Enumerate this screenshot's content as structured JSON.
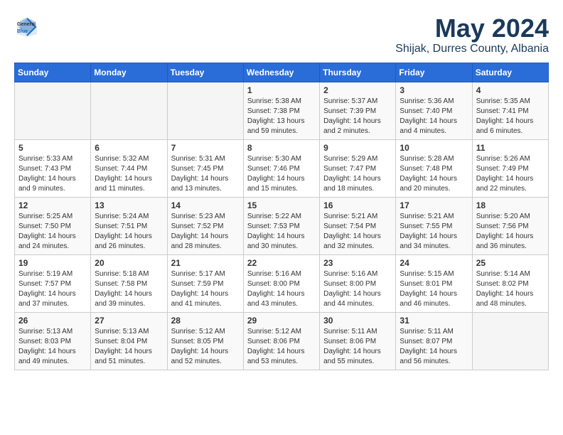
{
  "header": {
    "logo": {
      "general": "General",
      "blue": "Blue"
    },
    "month": "May 2024",
    "location": "Shijak, Durres County, Albania"
  },
  "days_of_week": [
    "Sunday",
    "Monday",
    "Tuesday",
    "Wednesday",
    "Thursday",
    "Friday",
    "Saturday"
  ],
  "weeks": [
    [
      {
        "day": "",
        "info": ""
      },
      {
        "day": "",
        "info": ""
      },
      {
        "day": "",
        "info": ""
      },
      {
        "day": "1",
        "sunrise": "Sunrise: 5:38 AM",
        "sunset": "Sunset: 7:38 PM",
        "daylight": "Daylight: 13 hours and 59 minutes."
      },
      {
        "day": "2",
        "sunrise": "Sunrise: 5:37 AM",
        "sunset": "Sunset: 7:39 PM",
        "daylight": "Daylight: 14 hours and 2 minutes."
      },
      {
        "day": "3",
        "sunrise": "Sunrise: 5:36 AM",
        "sunset": "Sunset: 7:40 PM",
        "daylight": "Daylight: 14 hours and 4 minutes."
      },
      {
        "day": "4",
        "sunrise": "Sunrise: 5:35 AM",
        "sunset": "Sunset: 7:41 PM",
        "daylight": "Daylight: 14 hours and 6 minutes."
      }
    ],
    [
      {
        "day": "5",
        "sunrise": "Sunrise: 5:33 AM",
        "sunset": "Sunset: 7:43 PM",
        "daylight": "Daylight: 14 hours and 9 minutes."
      },
      {
        "day": "6",
        "sunrise": "Sunrise: 5:32 AM",
        "sunset": "Sunset: 7:44 PM",
        "daylight": "Daylight: 14 hours and 11 minutes."
      },
      {
        "day": "7",
        "sunrise": "Sunrise: 5:31 AM",
        "sunset": "Sunset: 7:45 PM",
        "daylight": "Daylight: 14 hours and 13 minutes."
      },
      {
        "day": "8",
        "sunrise": "Sunrise: 5:30 AM",
        "sunset": "Sunset: 7:46 PM",
        "daylight": "Daylight: 14 hours and 15 minutes."
      },
      {
        "day": "9",
        "sunrise": "Sunrise: 5:29 AM",
        "sunset": "Sunset: 7:47 PM",
        "daylight": "Daylight: 14 hours and 18 minutes."
      },
      {
        "day": "10",
        "sunrise": "Sunrise: 5:28 AM",
        "sunset": "Sunset: 7:48 PM",
        "daylight": "Daylight: 14 hours and 20 minutes."
      },
      {
        "day": "11",
        "sunrise": "Sunrise: 5:26 AM",
        "sunset": "Sunset: 7:49 PM",
        "daylight": "Daylight: 14 hours and 22 minutes."
      }
    ],
    [
      {
        "day": "12",
        "sunrise": "Sunrise: 5:25 AM",
        "sunset": "Sunset: 7:50 PM",
        "daylight": "Daylight: 14 hours and 24 minutes."
      },
      {
        "day": "13",
        "sunrise": "Sunrise: 5:24 AM",
        "sunset": "Sunset: 7:51 PM",
        "daylight": "Daylight: 14 hours and 26 minutes."
      },
      {
        "day": "14",
        "sunrise": "Sunrise: 5:23 AM",
        "sunset": "Sunset: 7:52 PM",
        "daylight": "Daylight: 14 hours and 28 minutes."
      },
      {
        "day": "15",
        "sunrise": "Sunrise: 5:22 AM",
        "sunset": "Sunset: 7:53 PM",
        "daylight": "Daylight: 14 hours and 30 minutes."
      },
      {
        "day": "16",
        "sunrise": "Sunrise: 5:21 AM",
        "sunset": "Sunset: 7:54 PM",
        "daylight": "Daylight: 14 hours and 32 minutes."
      },
      {
        "day": "17",
        "sunrise": "Sunrise: 5:21 AM",
        "sunset": "Sunset: 7:55 PM",
        "daylight": "Daylight: 14 hours and 34 minutes."
      },
      {
        "day": "18",
        "sunrise": "Sunrise: 5:20 AM",
        "sunset": "Sunset: 7:56 PM",
        "daylight": "Daylight: 14 hours and 36 minutes."
      }
    ],
    [
      {
        "day": "19",
        "sunrise": "Sunrise: 5:19 AM",
        "sunset": "Sunset: 7:57 PM",
        "daylight": "Daylight: 14 hours and 37 minutes."
      },
      {
        "day": "20",
        "sunrise": "Sunrise: 5:18 AM",
        "sunset": "Sunset: 7:58 PM",
        "daylight": "Daylight: 14 hours and 39 minutes."
      },
      {
        "day": "21",
        "sunrise": "Sunrise: 5:17 AM",
        "sunset": "Sunset: 7:59 PM",
        "daylight": "Daylight: 14 hours and 41 minutes."
      },
      {
        "day": "22",
        "sunrise": "Sunrise: 5:16 AM",
        "sunset": "Sunset: 8:00 PM",
        "daylight": "Daylight: 14 hours and 43 minutes."
      },
      {
        "day": "23",
        "sunrise": "Sunrise: 5:16 AM",
        "sunset": "Sunset: 8:00 PM",
        "daylight": "Daylight: 14 hours and 44 minutes."
      },
      {
        "day": "24",
        "sunrise": "Sunrise: 5:15 AM",
        "sunset": "Sunset: 8:01 PM",
        "daylight": "Daylight: 14 hours and 46 minutes."
      },
      {
        "day": "25",
        "sunrise": "Sunrise: 5:14 AM",
        "sunset": "Sunset: 8:02 PM",
        "daylight": "Daylight: 14 hours and 48 minutes."
      }
    ],
    [
      {
        "day": "26",
        "sunrise": "Sunrise: 5:13 AM",
        "sunset": "Sunset: 8:03 PM",
        "daylight": "Daylight: 14 hours and 49 minutes."
      },
      {
        "day": "27",
        "sunrise": "Sunrise: 5:13 AM",
        "sunset": "Sunset: 8:04 PM",
        "daylight": "Daylight: 14 hours and 51 minutes."
      },
      {
        "day": "28",
        "sunrise": "Sunrise: 5:12 AM",
        "sunset": "Sunset: 8:05 PM",
        "daylight": "Daylight: 14 hours and 52 minutes."
      },
      {
        "day": "29",
        "sunrise": "Sunrise: 5:12 AM",
        "sunset": "Sunset: 8:06 PM",
        "daylight": "Daylight: 14 hours and 53 minutes."
      },
      {
        "day": "30",
        "sunrise": "Sunrise: 5:11 AM",
        "sunset": "Sunset: 8:06 PM",
        "daylight": "Daylight: 14 hours and 55 minutes."
      },
      {
        "day": "31",
        "sunrise": "Sunrise: 5:11 AM",
        "sunset": "Sunset: 8:07 PM",
        "daylight": "Daylight: 14 hours and 56 minutes."
      },
      {
        "day": "",
        "info": ""
      }
    ]
  ]
}
